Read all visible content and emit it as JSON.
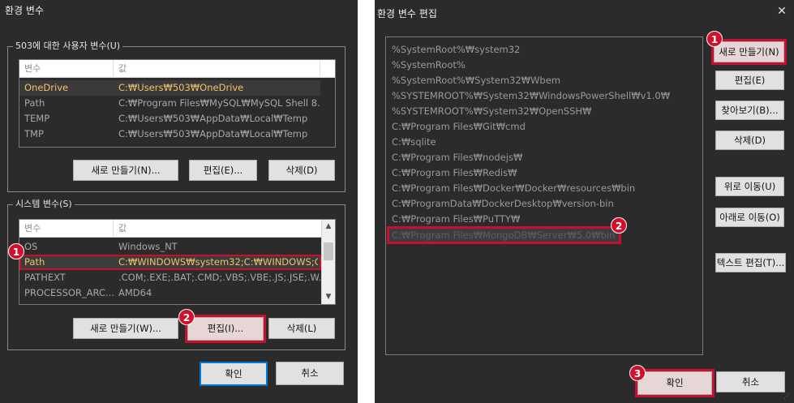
{
  "left_dialog": {
    "title": "환경 변수",
    "user_vars": {
      "group_label": "503에 대한 사용자 변수(U)",
      "columns": [
        "변수",
        "값"
      ],
      "rows": [
        {
          "name": "OneDrive",
          "value": "C:₩Users₩503₩OneDrive"
        },
        {
          "name": "Path",
          "value": "C:₩Program Files₩MySQL₩MySQL Shell 8...."
        },
        {
          "name": "TEMP",
          "value": "C:₩Users₩503₩AppData₩Local₩Temp"
        },
        {
          "name": "TMP",
          "value": "C:₩Users₩503₩AppData₩Local₩Temp"
        }
      ],
      "buttons": {
        "new": "새로 만들기(N)...",
        "edit": "편집(E)...",
        "delete": "삭제(D)"
      }
    },
    "system_vars": {
      "group_label": "시스템 변수(S)",
      "columns": [
        "변수",
        "값"
      ],
      "rows": [
        {
          "name": "OS",
          "value": "Windows_NT"
        },
        {
          "name": "Path",
          "value": "C:₩WINDOWS₩system32;C:₩WINDOWS;C..."
        },
        {
          "name": "PATHEXT",
          "value": ".COM;.EXE;.BAT;.CMD;.VBS;.VBE;.JS;.JSE;.W..."
        },
        {
          "name": "PROCESSOR_ARC...",
          "value": "AMD64"
        }
      ],
      "buttons": {
        "new": "새로 만들기(W)...",
        "edit": "편집(I)...",
        "delete": "삭제(L)"
      }
    },
    "ok_label": "확인",
    "cancel_label": "취소",
    "badges": [
      "1",
      "2"
    ]
  },
  "right_dialog": {
    "title": "환경 변수 편집",
    "close_glyph": "✕",
    "paths": [
      "%SystemRoot%₩system32",
      "%SystemRoot%",
      "%SystemRoot%₩System32₩Wbem",
      "%SYSTEMROOT%₩System32₩WindowsPowerShell₩v1.0₩",
      "%SYSTEMROOT%₩System32₩OpenSSH₩",
      "C:₩Program Files₩Git₩cmd",
      "C:₩sqlite",
      "C:₩Program Files₩nodejs₩",
      "C:₩Program Files₩Redis₩",
      "C:₩Program Files₩Docker₩Docker₩resources₩bin",
      "C:₩ProgramData₩DockerDesktop₩version-bin",
      "C:₩Program Files₩PuTTY₩",
      "C:₩Program Files₩MongoDB₩Server₩5.0₩bin"
    ],
    "buttons": {
      "new": "새로 만들기(N)",
      "edit": "편집(E)",
      "browse": "찾아보기(B)...",
      "delete": "삭제(D)",
      "move_up": "위로 이동(U)",
      "move_down": "아래로 이동(O)",
      "edit_text": "텍스트 편집(T)..."
    },
    "ok_label": "확인",
    "cancel_label": "취소",
    "badges": [
      "1",
      "2",
      "3"
    ]
  }
}
